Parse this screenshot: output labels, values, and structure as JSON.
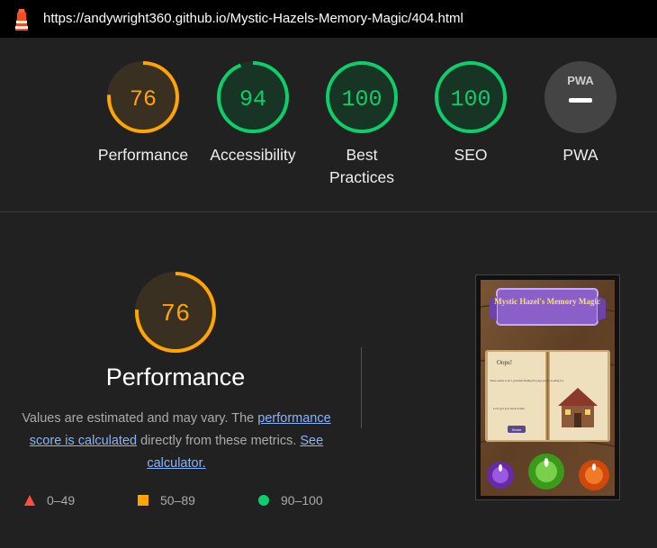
{
  "url": "https://andywright360.github.io/Mystic-Hazels-Memory-Magic/404.html",
  "categories": [
    {
      "label": "Performance",
      "score": "76",
      "status": "average"
    },
    {
      "label": "Accessibility",
      "score": "94",
      "status": "pass"
    },
    {
      "label": "Best Practices",
      "score": "100",
      "status": "pass"
    },
    {
      "label": "SEO",
      "score": "100",
      "status": "pass"
    },
    {
      "label": "PWA",
      "score": "",
      "status": "na"
    }
  ],
  "pwa_badge": "PWA",
  "detail": {
    "score": "76",
    "title": "Performance",
    "desc_1": "Values are estimated and may vary. The ",
    "link_1": "performance score is calculated",
    "desc_2": " directly from these metrics. ",
    "link_2": "See calculator."
  },
  "legend": {
    "fail": "0–49",
    "average": "50–89",
    "pass": "90–100"
  },
  "preview": {
    "banner": "Mystic Hazel's Memory Magic",
    "heading": "Oops!",
    "body": "There seems to be a problem finding the page you're looking for.",
    "body2": "Let's get you back home!",
    "button": "Home"
  },
  "colors": {
    "pass": "#0cce6b",
    "average": "#ffa400",
    "fail": "#ff4e42",
    "na": "#444444"
  },
  "icons": {
    "logo": "lighthouse-icon",
    "fail": "triangle-icon",
    "average": "square-icon",
    "pass": "circle-icon"
  }
}
